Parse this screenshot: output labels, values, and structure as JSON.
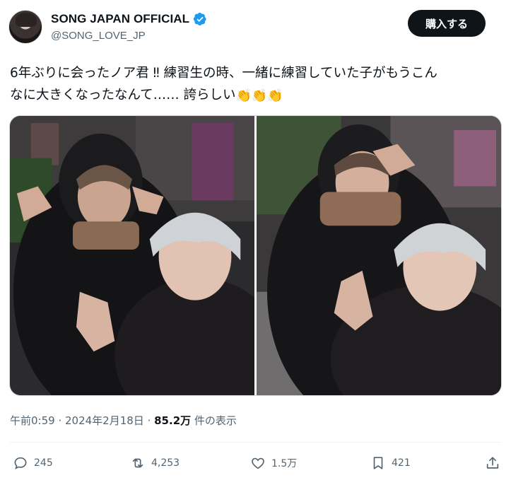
{
  "account": {
    "display_name": "SONG JAPAN OFFICIAL",
    "handle": "@SONG_LOVE_JP",
    "buy_label": "購入する"
  },
  "tweet": {
    "line1": "6年ぶりに会ったノア君 ‼ 練習生の時、一緒に練習していた子がもうこん",
    "line2_text": "なに大きくなったなんて…… 誇らしい",
    "emoji": "👏👏👏"
  },
  "meta": {
    "time": "午前0:59",
    "separator": " · ",
    "date": "2024年2月18日",
    "views_count": "85.2万",
    "views_suffix": " 件の表示"
  },
  "actions": {
    "replies": "245",
    "reposts": "4,253",
    "likes": "1.5万",
    "bookmarks": "421"
  },
  "icons": {
    "verified": "verified-badge-icon",
    "reply": "reply-icon",
    "repost": "repost-icon",
    "like": "heart-icon",
    "bookmark": "bookmark-icon",
    "share": "share-icon"
  },
  "colors": {
    "verified_blue": "#1d9bf0",
    "text_primary": "#0f1419",
    "text_secondary": "#536471",
    "button_bg": "#0f1419"
  }
}
